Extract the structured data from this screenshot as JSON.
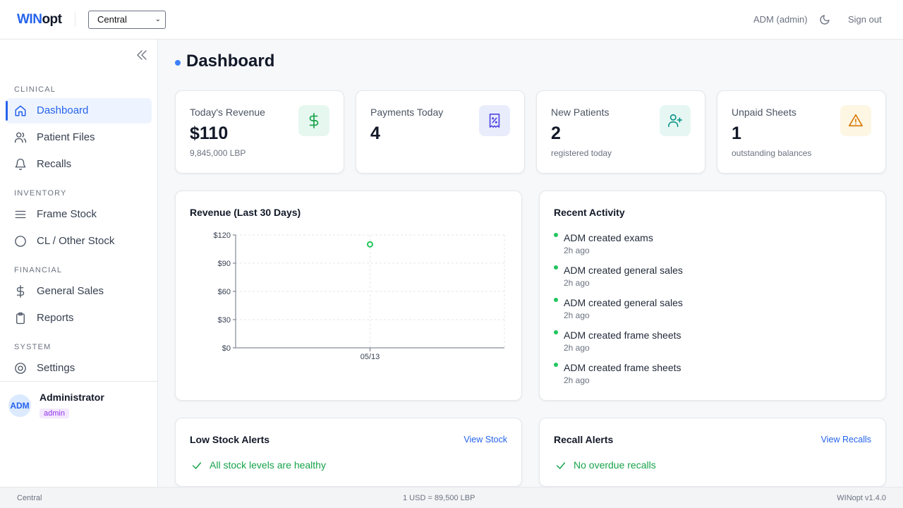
{
  "header": {
    "logo_part1": "WIN",
    "logo_part2": "opt",
    "branch_selected": "Central",
    "user": "ADM (admin)",
    "sign_out": "Sign out"
  },
  "sidebar": {
    "sections": [
      {
        "title": "CLINICAL"
      },
      {
        "title": "INVENTORY"
      },
      {
        "title": "FINANCIAL"
      },
      {
        "title": "SYSTEM"
      }
    ],
    "items": [
      {
        "label": "Dashboard",
        "icon": "home-icon",
        "active": true
      },
      {
        "label": "Patient Files",
        "icon": "users-icon"
      },
      {
        "label": "Recalls",
        "icon": "bell-icon"
      },
      {
        "label": "Frame Stock",
        "icon": "list-icon"
      },
      {
        "label": "CL / Other Stock",
        "icon": "circle-icon"
      },
      {
        "label": "General Sales",
        "icon": "dollar-icon"
      },
      {
        "label": "Reports",
        "icon": "clipboard-icon"
      },
      {
        "label": "Settings",
        "icon": "target-icon"
      }
    ],
    "profile": {
      "initials": "ADM",
      "name": "Administrator",
      "role": "admin"
    }
  },
  "main": {
    "title": "Dashboard",
    "stats": [
      {
        "label": "Today's Revenue",
        "value": "$110",
        "sub": "9,845,000 LBP",
        "icon": "dollar-icon",
        "bg": "#e6f7f0",
        "fg": "#16a34a"
      },
      {
        "label": "Payments Today",
        "value": "4",
        "sub": "",
        "icon": "receipt-icon",
        "bg": "#e9ecfb",
        "fg": "#4f46e5"
      },
      {
        "label": "New Patients",
        "value": "2",
        "sub": "registered today",
        "icon": "user-plus-icon",
        "bg": "#e6f7f3",
        "fg": "#0d9488"
      },
      {
        "label": "Unpaid Sheets",
        "value": "1",
        "sub": "outstanding balances",
        "icon": "warning-icon",
        "bg": "#fdf6e3",
        "fg": "#d97706"
      }
    ],
    "revenue_card": {
      "title": "Revenue (Last 30 Days)"
    },
    "activity": {
      "title": "Recent Activity",
      "items": [
        {
          "text": "ADM created exams",
          "time": "2h ago"
        },
        {
          "text": "ADM created general sales",
          "time": "2h ago"
        },
        {
          "text": "ADM created general sales",
          "time": "2h ago"
        },
        {
          "text": "ADM created frame sheets",
          "time": "2h ago"
        },
        {
          "text": "ADM created frame sheets",
          "time": "2h ago"
        }
      ]
    },
    "low_stock": {
      "title": "Low Stock Alerts",
      "link": "View Stock",
      "message": "All stock levels are healthy"
    },
    "recalls": {
      "title": "Recall Alerts",
      "link": "View Recalls",
      "message": "No overdue recalls"
    }
  },
  "chart_data": {
    "type": "line",
    "title": "Revenue (Last 30 Days)",
    "x": [
      "05/13"
    ],
    "series": [
      {
        "values": [
          110
        ]
      }
    ],
    "ylim": [
      0,
      120
    ],
    "yticks": [
      "$0",
      "$30",
      "$60",
      "$90",
      "$120"
    ],
    "ytick_values": [
      0,
      30,
      60,
      90,
      120
    ],
    "grid": true,
    "color": "#22c55e"
  },
  "footer": {
    "branch": "Central",
    "rate": "1 USD = 89,500 LBP",
    "version": "WINopt v1.4.0"
  }
}
